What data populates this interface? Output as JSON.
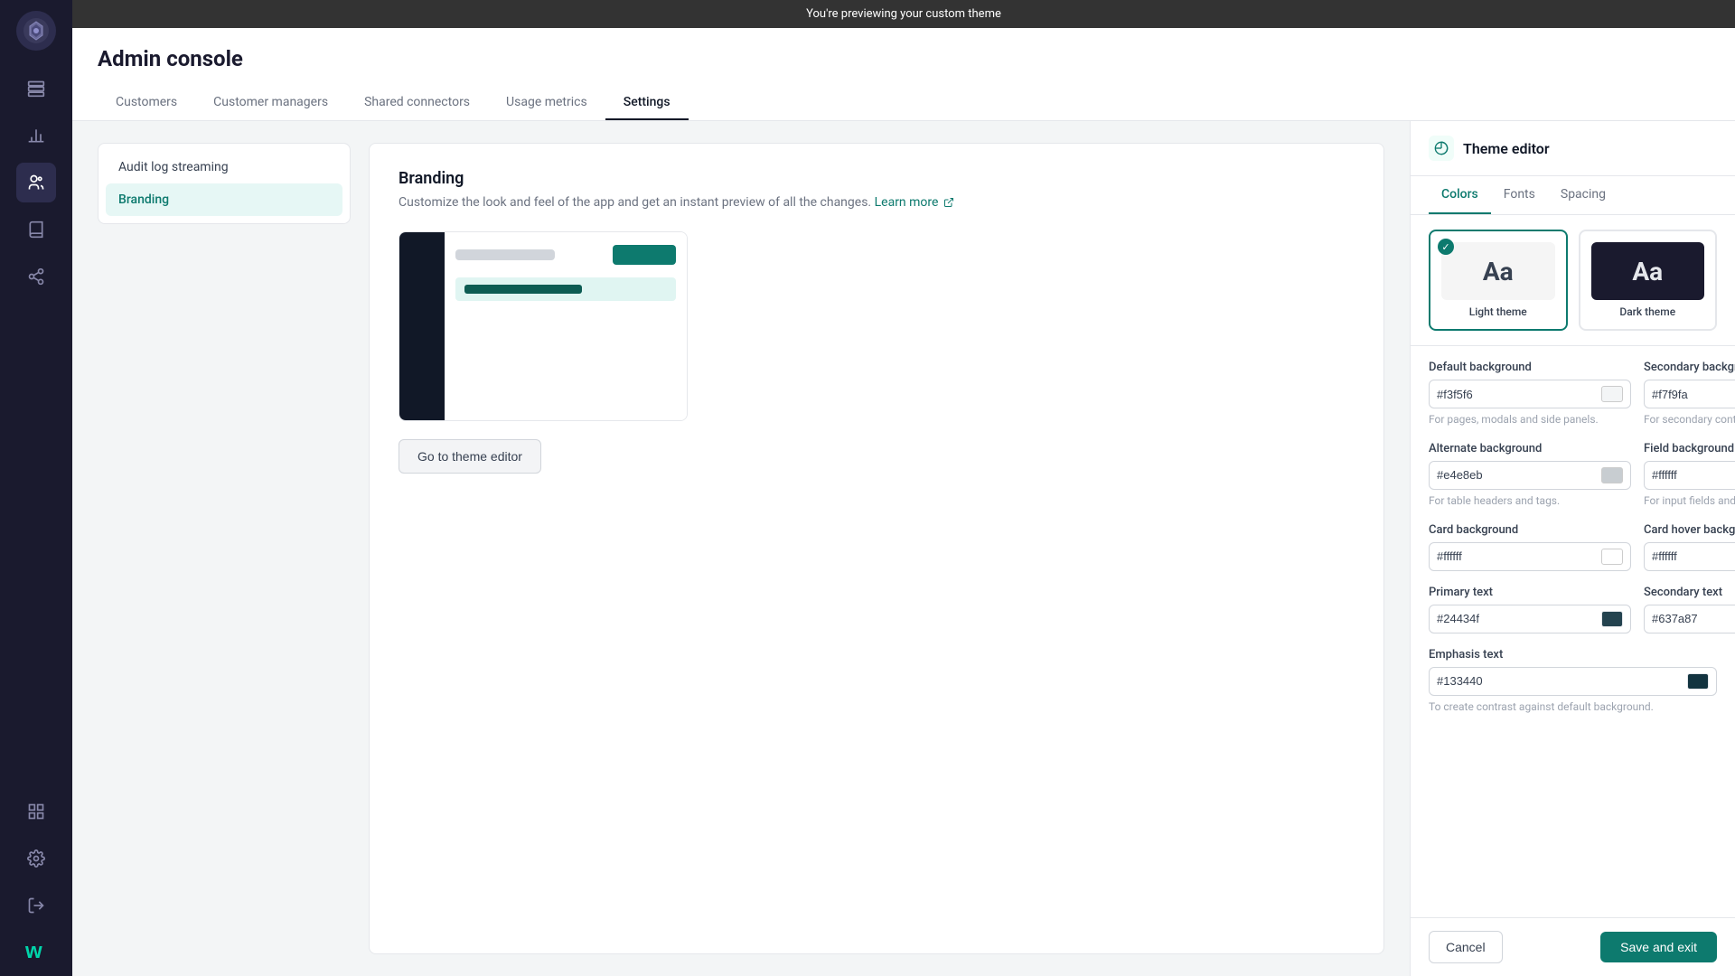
{
  "preview_banner": {
    "text": "You're previewing your custom theme"
  },
  "sidebar": {
    "logo_alt": "App logo",
    "icons": [
      {
        "name": "layers-icon",
        "symbol": "⊞",
        "active": false
      },
      {
        "name": "chart-icon",
        "symbol": "📊",
        "active": false
      },
      {
        "name": "users-icon",
        "symbol": "👥",
        "active": true
      },
      {
        "name": "book-icon",
        "symbol": "📖",
        "active": false
      },
      {
        "name": "share-icon",
        "symbol": "⇄",
        "active": false
      },
      {
        "name": "settings-icon",
        "symbol": "⚙",
        "active": false
      },
      {
        "name": "logout-icon",
        "symbol": "→",
        "active": false
      }
    ],
    "workato_logo": "w"
  },
  "header": {
    "title": "Admin console",
    "tabs": [
      {
        "id": "customers",
        "label": "Customers",
        "active": false
      },
      {
        "id": "customer-managers",
        "label": "Customer managers",
        "active": false
      },
      {
        "id": "shared-connectors",
        "label": "Shared connectors",
        "active": false
      },
      {
        "id": "usage-metrics",
        "label": "Usage metrics",
        "active": false
      },
      {
        "id": "settings",
        "label": "Settings",
        "active": true
      }
    ]
  },
  "left_panel": {
    "items": [
      {
        "id": "audit-log",
        "label": "Audit log streaming",
        "active": false
      },
      {
        "id": "branding",
        "label": "Branding",
        "active": true
      }
    ]
  },
  "branding": {
    "title": "Branding",
    "description": "Customize the look and feel of the app and get an instant preview of all the changes.",
    "learn_more_label": "Learn more",
    "theme_editor_btn": "Go to theme editor"
  },
  "theme_editor": {
    "title": "Theme editor",
    "tabs": [
      {
        "id": "colors",
        "label": "Colors",
        "active": true
      },
      {
        "id": "fonts",
        "label": "Fonts",
        "active": false
      },
      {
        "id": "spacing",
        "label": "Spacing",
        "active": false
      }
    ],
    "themes": [
      {
        "id": "light",
        "label": "Light theme",
        "selected": true,
        "preview_text": "Aa",
        "style": "light"
      },
      {
        "id": "dark",
        "label": "Dark theme",
        "selected": false,
        "preview_text": "Aa",
        "style": "dark"
      }
    ],
    "color_sections": [
      {
        "row": [
          {
            "id": "default-bg",
            "label": "Default background",
            "value": "#f3f5f6",
            "swatch": "#f3f5f6",
            "hint": "For pages, modals and side panels."
          },
          {
            "id": "secondary-bg",
            "label": "Secondary background",
            "value": "#f7f9fa",
            "swatch": "#f7f9fa",
            "hint": "For secondary content or disabled state."
          }
        ]
      },
      {
        "row": [
          {
            "id": "alternate-bg",
            "label": "Alternate background",
            "value": "#e4e8eb",
            "swatch": "#c8cdd1",
            "hint": "For table headers and tags."
          },
          {
            "id": "field-bg",
            "label": "Field background",
            "value": "#ffffff",
            "swatch": "#ffffff",
            "hint": "For input fields and canvas."
          }
        ]
      },
      {
        "row": [
          {
            "id": "card-bg",
            "label": "Card background",
            "value": "#ffffff",
            "swatch": "#ffffff",
            "hint": ""
          },
          {
            "id": "card-hover-bg",
            "label": "Card hover background",
            "value": "#ffffff",
            "swatch": "#ffffff",
            "hint": ""
          }
        ]
      },
      {
        "row": [
          {
            "id": "primary-text",
            "label": "Primary text",
            "value": "#24434f",
            "swatch": "#24434f",
            "hint": ""
          },
          {
            "id": "secondary-text",
            "label": "Secondary text",
            "value": "#637a87",
            "swatch": "#637a87",
            "hint": ""
          }
        ]
      },
      {
        "row": [
          {
            "id": "emphasis-text",
            "label": "Emphasis text",
            "value": "#133440",
            "swatch": "#133440",
            "hint": "To create contrast against default background."
          }
        ]
      }
    ],
    "footer": {
      "cancel_label": "Cancel",
      "save_label": "Save and exit"
    }
  }
}
